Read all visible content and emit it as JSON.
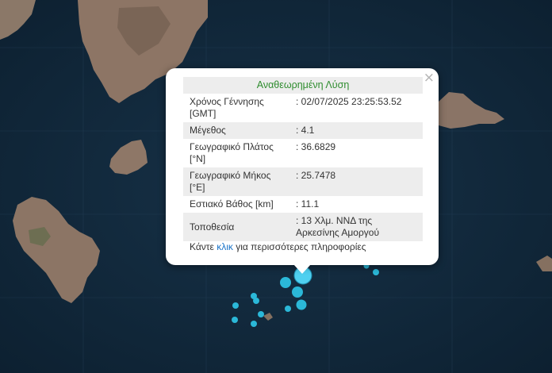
{
  "popup": {
    "title": "Αναθεωρημένη Λύση",
    "close_symbol": "×",
    "rows": [
      {
        "label": "Χρόνος Γέννησης [GMT]",
        "value": ": 02/07/2025 23:25:53.52"
      },
      {
        "label": "Μέγεθος",
        "value": ": 4.1"
      },
      {
        "label": "Γεωγραφικό Πλάτος [°N]",
        "value": ": 36.6829"
      },
      {
        "label": "Γεωγραφικό Μήκος [°E]",
        "value": ": 25.7478"
      },
      {
        "label": "Εστιακό Βάθος [km]",
        "value": ": 11.1"
      },
      {
        "label": "Τοποθεσία",
        "value": ": 13 Χλμ. ΝΝΔ της Αρκεσίνης Αμοργού"
      }
    ],
    "more_prefix": "Κάντε ",
    "more_link": "κλικ",
    "more_suffix": " για περισσότερες πληροφορίες"
  },
  "map": {
    "sea_color": "#11283b",
    "land_color": "#8a7466",
    "marker_color": "#2bb8d8",
    "main_marker_color": "#4fd0f0"
  }
}
